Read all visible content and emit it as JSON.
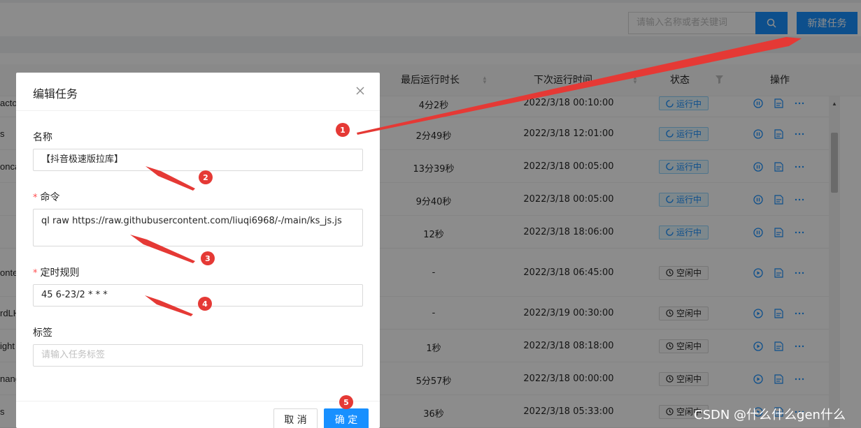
{
  "header": {
    "search_placeholder": "请输入名称或者关键词",
    "new_task_label": "新建任务"
  },
  "table": {
    "columns": {
      "last_run_duration": "最后运行时长",
      "next_run_time": "下次运行时间",
      "status": "状态",
      "actions": "操作"
    },
    "rows": [
      {
        "name": "acto",
        "duration": "4分2秒",
        "next": "2022/3/18 00:10:00",
        "status": "运行中",
        "state": "running"
      },
      {
        "name": "s",
        "duration": "2分49秒",
        "next": "2022/3/18 12:01:00",
        "status": "运行中",
        "state": "running"
      },
      {
        "name": "onca",
        "duration": "13分39秒",
        "next": "2022/3/18 00:05:00",
        "status": "运行中",
        "state": "running"
      },
      {
        "name": "",
        "duration": "9分40秒",
        "next": "2022/3/18 00:05:00",
        "status": "运行中",
        "state": "running"
      },
      {
        "name": "",
        "duration": "12秒",
        "next": "2022/3/18 18:06:00",
        "status": "运行中",
        "state": "running"
      },
      {
        "name": "onte",
        "duration": "-",
        "next": "2022/3/18 06:45:00",
        "status": "空闲中",
        "state": "idle"
      },
      {
        "name": "rdLH",
        "duration": "-",
        "next": "2022/3/19 00:30:00",
        "status": "空闲中",
        "state": "idle"
      },
      {
        "name": "ight",
        "duration": "1秒",
        "next": "2022/3/18 08:18:00",
        "status": "空闲中",
        "state": "idle"
      },
      {
        "name": "nang",
        "duration": "5分57秒",
        "next": "2022/3/18 00:00:00",
        "status": "空闲中",
        "state": "idle"
      },
      {
        "name": "s",
        "duration": "36秒",
        "next": "2022/3/18 05:33:00",
        "status": "空闲中",
        "state": "idle"
      }
    ]
  },
  "modal": {
    "title": "编辑任务",
    "fields": {
      "name_label": "名称",
      "name_value": "【抖音极速版拉库】",
      "command_label": "命令",
      "command_value": "ql raw https://raw.githubusercontent.com/liuqi6968/-/main/ks_js.js",
      "cron_label": "定时规则",
      "cron_value": "45 6-23/2 * * *",
      "tag_label": "标签",
      "tag_placeholder": "请输入任务标签"
    },
    "cancel_label": "取 消",
    "ok_label": "确 定"
  },
  "annotations": [
    "1",
    "2",
    "3",
    "4",
    "5"
  ],
  "watermark": "CSDN @什么什么gen什么",
  "colors": {
    "primary": "#1890ff",
    "marker": "#e53935",
    "required": "#ff4d4f"
  }
}
